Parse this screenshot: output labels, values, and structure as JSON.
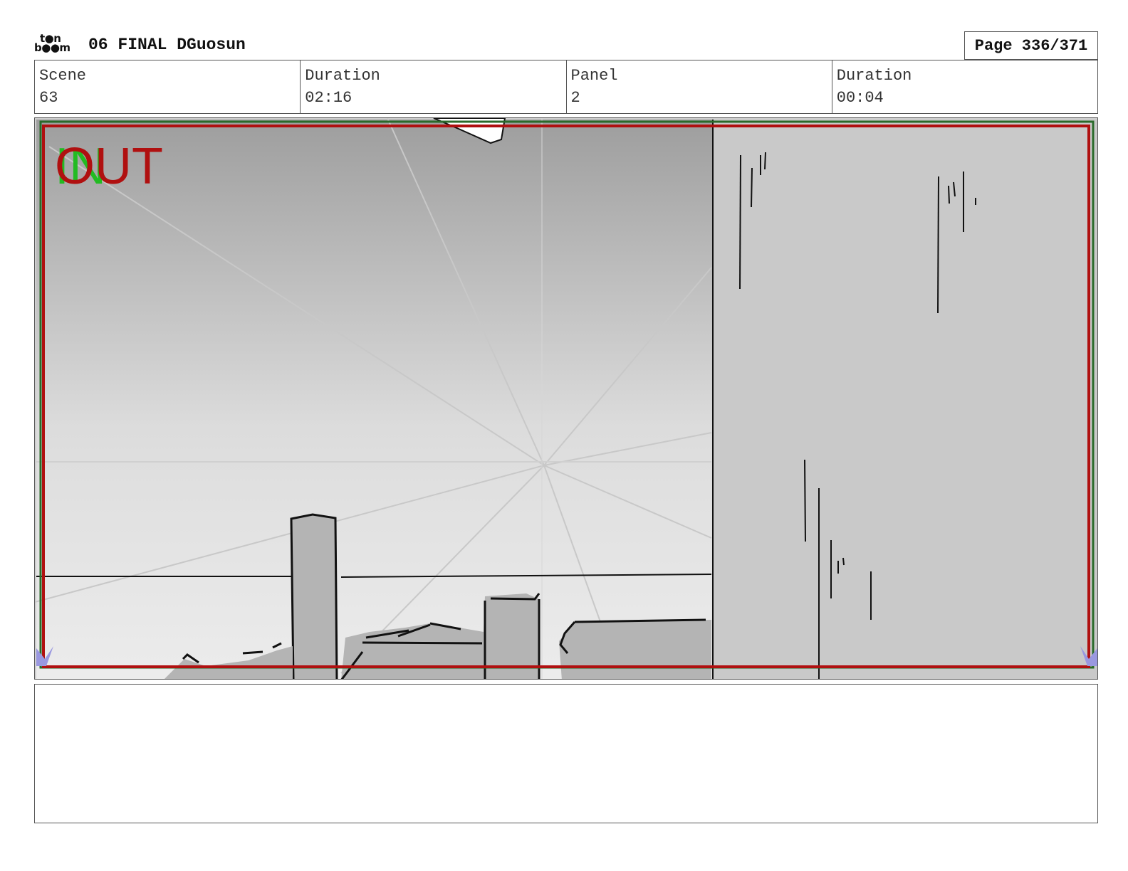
{
  "header": {
    "logo_line1": "t●n",
    "logo_line2": "b●●m",
    "title": "06 FINAL DGuosun",
    "page_label": "Page 336/371"
  },
  "info": [
    {
      "label": "Scene",
      "value": "63"
    },
    {
      "label": "Duration",
      "value": "02:16"
    },
    {
      "label": "Panel",
      "value": "2"
    },
    {
      "label": "Duration",
      "value": "00:04"
    }
  ],
  "panel": {
    "in_label": "IN",
    "out_label": "OUT",
    "colors": {
      "safe_frame": "#b01010",
      "in_marker": "#22bb22",
      "field_guide": "#2a6a2a",
      "corner_marker": "#9a98e0"
    }
  },
  "notes": {
    "text": ""
  }
}
